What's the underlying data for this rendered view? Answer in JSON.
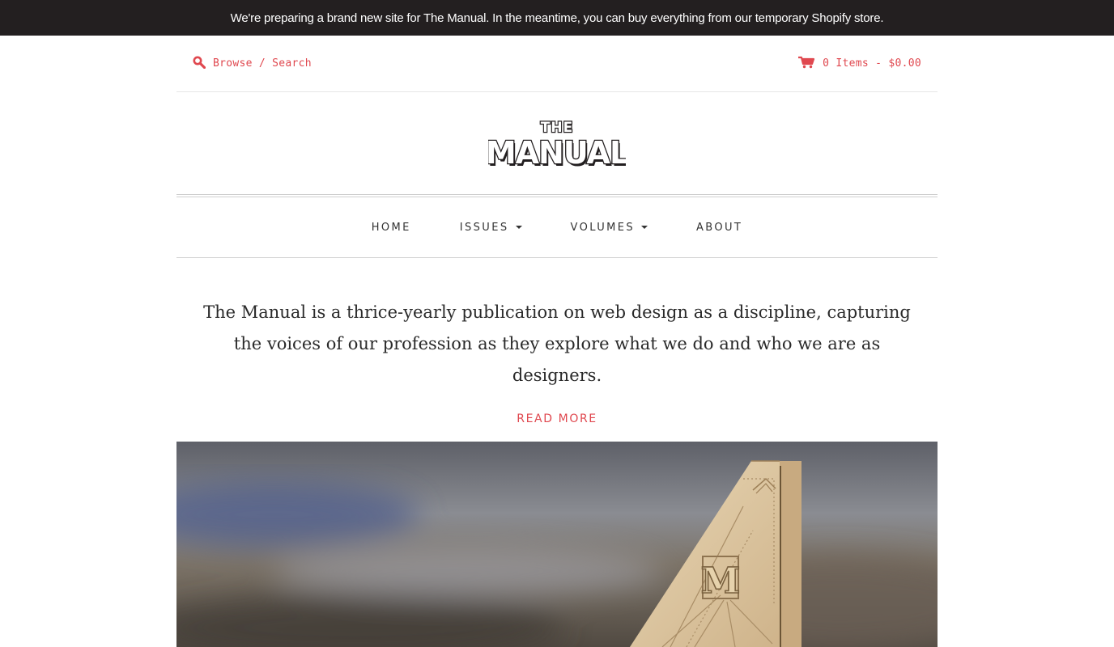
{
  "announcement": "We're preparing a brand new site for The Manual. In the meantime, you can buy everything from our temporary Shopify store.",
  "utility": {
    "search_icon": "search-icon",
    "browse_label": "Browse / Search",
    "cart_icon": "cart-icon",
    "cart_label": "0 Items - $0.00"
  },
  "logo": {
    "line1": "THE",
    "line2": "MANUAL"
  },
  "nav": {
    "items": [
      {
        "label": "HOME",
        "dropdown": false
      },
      {
        "label": "ISSUES",
        "dropdown": true
      },
      {
        "label": "VOLUMES",
        "dropdown": true
      },
      {
        "label": "ABOUT",
        "dropdown": false
      }
    ]
  },
  "intro": {
    "text": "The Manual is a thrice-yearly publication on web design as a discipline, capturing the voices of our profession as they explore what we do and who we are as designers.",
    "read_more": "READ MORE"
  },
  "hero": {
    "monogram": "M"
  },
  "colors": {
    "accent": "#e0484f",
    "bar": "#231f20",
    "wood": "#d9c19a"
  }
}
